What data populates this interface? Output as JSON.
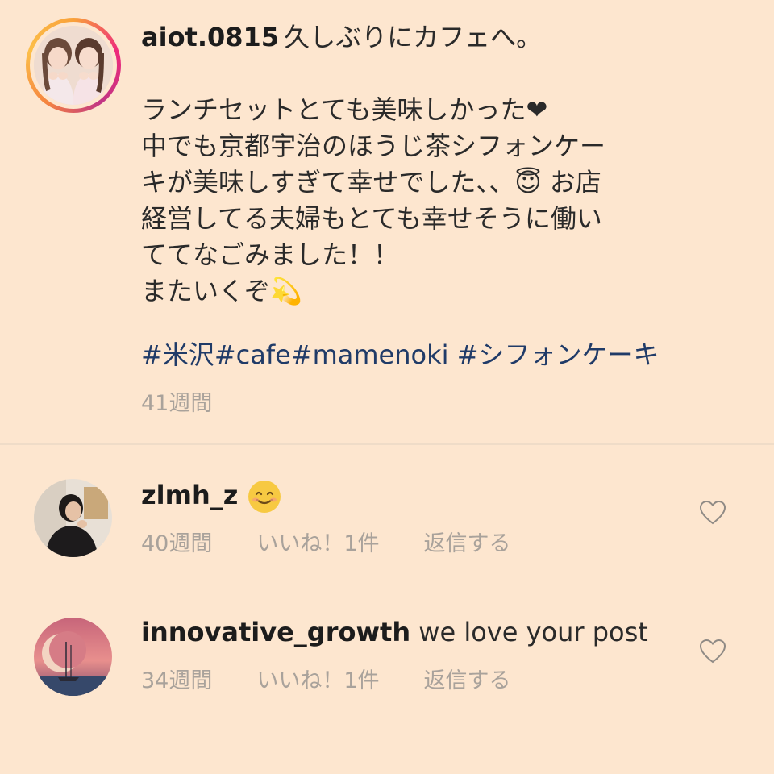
{
  "post": {
    "username": "aiot.0815",
    "caption_lines": [
      "久しぶりにカフェへ。",
      "",
      "ランチセットとても美味しかった❤︎",
      "中でも京都宇治のほうじ茶シフォンケー",
      "キが美味しすぎて幸せでした、、😇 お店",
      "経営してる夫婦もとても幸せそうに働い",
      "ててなごみました！！",
      "またいくぞ💫"
    ],
    "hashtags": "#米沢#cafe#mamenoki #シフォンケーキ",
    "time": "41週間",
    "accent_colors": [
      "#f9a23a",
      "#ee2a7b",
      "#c13584"
    ]
  },
  "comments": [
    {
      "username": "zlmh_z",
      "text": "😊",
      "time": "40週間",
      "likes": "いいね！1件",
      "reply": "返信する"
    },
    {
      "username": "innovative_growth",
      "text": "we love your post",
      "time": "34週間",
      "likes": "いいね！1件",
      "reply": "返信する"
    }
  ],
  "colors": {
    "background": "#fde6cf",
    "hashtag": "#203b68",
    "muted": "#a9a29b"
  }
}
